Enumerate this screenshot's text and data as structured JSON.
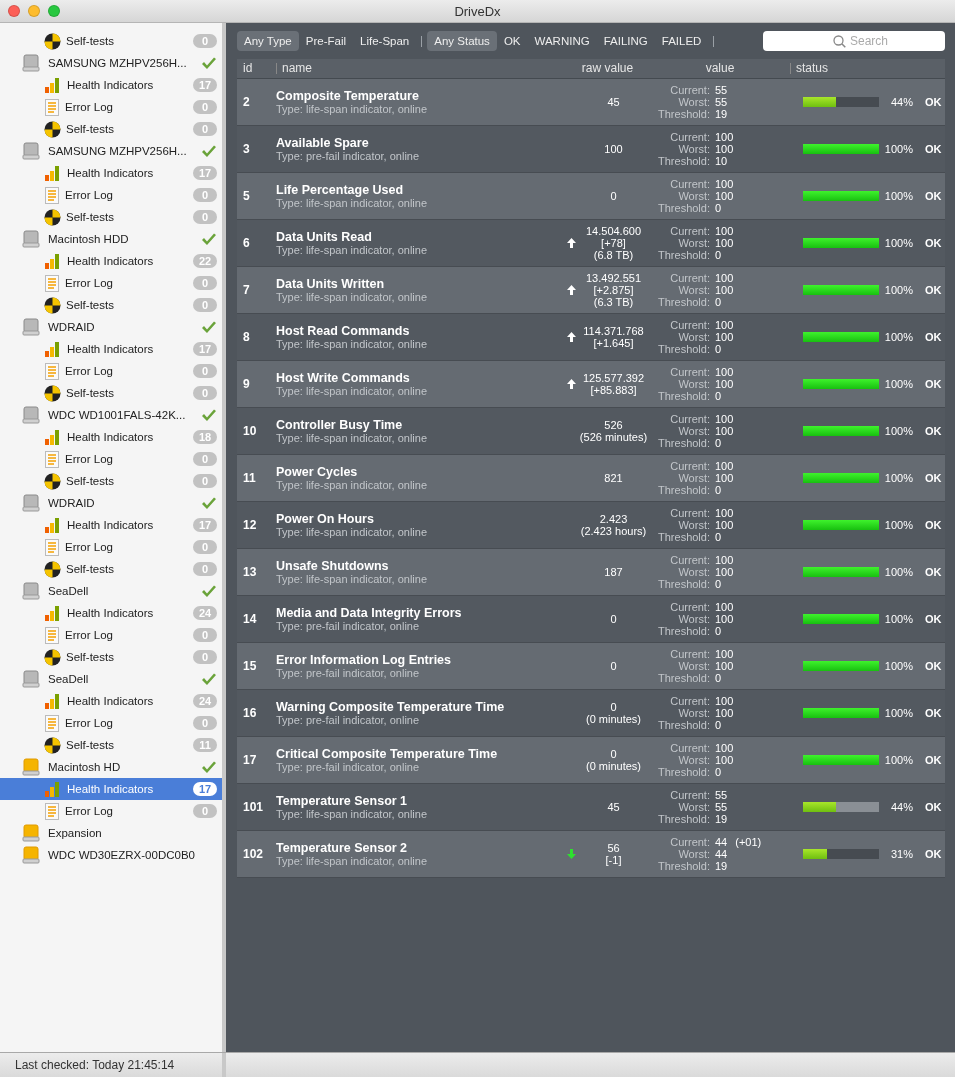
{
  "window": {
    "title": "DriveDx"
  },
  "sidebar": {
    "leading_items": [
      {
        "kind": "tests",
        "label": "Self-tests",
        "count": "0",
        "selected": false
      }
    ],
    "drives": [
      {
        "name": "SAMSUNG MZHPV256H...",
        "kind": "internal",
        "ok": true,
        "children": [
          {
            "kind": "health",
            "label": "Health Indicators",
            "count": "17",
            "selected": false
          },
          {
            "kind": "log",
            "label": "Error Log",
            "count": "0",
            "selected": false
          },
          {
            "kind": "tests",
            "label": "Self-tests",
            "count": "0",
            "selected": false
          }
        ]
      },
      {
        "name": "SAMSUNG MZHPV256H...",
        "kind": "internal",
        "ok": true,
        "children": [
          {
            "kind": "health",
            "label": "Health Indicators",
            "count": "17",
            "selected": false
          },
          {
            "kind": "log",
            "label": "Error Log",
            "count": "0",
            "selected": false
          },
          {
            "kind": "tests",
            "label": "Self-tests",
            "count": "0",
            "selected": false
          }
        ]
      },
      {
        "name": "Macintosh HDD",
        "kind": "internal",
        "ok": true,
        "children": [
          {
            "kind": "health",
            "label": "Health Indicators",
            "count": "22",
            "selected": false
          },
          {
            "kind": "log",
            "label": "Error Log",
            "count": "0",
            "selected": false
          },
          {
            "kind": "tests",
            "label": "Self-tests",
            "count": "0",
            "selected": false
          }
        ]
      },
      {
        "name": "WDRAID",
        "kind": "internal",
        "ok": true,
        "children": [
          {
            "kind": "health",
            "label": "Health Indicators",
            "count": "17",
            "selected": false
          },
          {
            "kind": "log",
            "label": "Error Log",
            "count": "0",
            "selected": false
          },
          {
            "kind": "tests",
            "label": "Self-tests",
            "count": "0",
            "selected": false
          }
        ]
      },
      {
        "name": "WDC WD1001FALS-42K...",
        "kind": "internal",
        "ok": true,
        "children": [
          {
            "kind": "health",
            "label": "Health Indicators",
            "count": "18",
            "selected": false
          },
          {
            "kind": "log",
            "label": "Error Log",
            "count": "0",
            "selected": false
          },
          {
            "kind": "tests",
            "label": "Self-tests",
            "count": "0",
            "selected": false
          }
        ]
      },
      {
        "name": "WDRAID",
        "kind": "internal",
        "ok": true,
        "children": [
          {
            "kind": "health",
            "label": "Health Indicators",
            "count": "17",
            "selected": false
          },
          {
            "kind": "log",
            "label": "Error Log",
            "count": "0",
            "selected": false
          },
          {
            "kind": "tests",
            "label": "Self-tests",
            "count": "0",
            "selected": false
          }
        ]
      },
      {
        "name": "SeaDell",
        "kind": "internal",
        "ok": true,
        "children": [
          {
            "kind": "health",
            "label": "Health Indicators",
            "count": "24",
            "selected": false
          },
          {
            "kind": "log",
            "label": "Error Log",
            "count": "0",
            "selected": false
          },
          {
            "kind": "tests",
            "label": "Self-tests",
            "count": "0",
            "selected": false
          }
        ]
      },
      {
        "name": "SeaDell",
        "kind": "internal",
        "ok": true,
        "children": [
          {
            "kind": "health",
            "label": "Health Indicators",
            "count": "24",
            "selected": false
          },
          {
            "kind": "log",
            "label": "Error Log",
            "count": "0",
            "selected": false
          },
          {
            "kind": "tests",
            "label": "Self-tests",
            "count": "11",
            "selected": false
          }
        ]
      },
      {
        "name": "Macintosh HD",
        "kind": "external",
        "ok": true,
        "children": [
          {
            "kind": "health",
            "label": "Health Indicators",
            "count": "17",
            "selected": true
          },
          {
            "kind": "log",
            "label": "Error Log",
            "count": "0",
            "selected": false
          }
        ]
      },
      {
        "name": "Expansion",
        "kind": "external",
        "ok": false
      },
      {
        "name": "WDC WD30EZRX-00DC0B0",
        "kind": "external",
        "ok": false
      }
    ]
  },
  "filters": {
    "type": [
      {
        "label": "Any Type",
        "selected": true
      },
      {
        "label": "Pre-Fail",
        "selected": false
      },
      {
        "label": "Life-Span",
        "selected": false
      }
    ],
    "status": [
      {
        "label": "Any Status",
        "selected": true
      },
      {
        "label": "OK",
        "selected": false
      },
      {
        "label": "WARNING",
        "selected": false
      },
      {
        "label": "FAILING",
        "selected": false
      },
      {
        "label": "FAILED",
        "selected": false
      }
    ]
  },
  "search": {
    "placeholder": "Search"
  },
  "table": {
    "columns": [
      "id",
      "name",
      "raw value",
      "value",
      "status"
    ],
    "rows": [
      {
        "id": "2",
        "name": "Composite Temperature",
        "type": "Type: life-span indicator, online",
        "raw": [
          "45"
        ],
        "values": [
          {
            "label": "Current:",
            "value": "55"
          },
          {
            "label": "Worst:",
            "value": "55"
          },
          {
            "label": "Threshold:",
            "value": "19"
          }
        ],
        "level": 0.44,
        "percent": "44%",
        "status": "OK"
      },
      {
        "id": "3",
        "name": "Available Spare",
        "type": "Type: pre-fail indicator, online",
        "raw": [
          "100"
        ],
        "values": [
          {
            "label": "Current:",
            "value": "100"
          },
          {
            "label": "Worst:",
            "value": "100"
          },
          {
            "label": "Threshold:",
            "value": "10"
          }
        ],
        "level": 1,
        "percent": "100%",
        "status": "OK"
      },
      {
        "id": "5",
        "name": "Life Percentage Used",
        "type": "Type: life-span indicator, online",
        "raw": [
          "0"
        ],
        "values": [
          {
            "label": "Current:",
            "value": "100"
          },
          {
            "label": "Worst:",
            "value": "100"
          },
          {
            "label": "Threshold:",
            "value": "0"
          }
        ],
        "level": 1,
        "percent": "100%",
        "status": "OK"
      },
      {
        "id": "6",
        "name": "Data Units Read",
        "type": "Type: life-span indicator, online",
        "raw": [
          "14.504.600",
          "[+78]",
          "(6.8 TB)"
        ],
        "rising": true,
        "values": [
          {
            "label": "Current:",
            "value": "100"
          },
          {
            "label": "Worst:",
            "value": "100"
          },
          {
            "label": "Threshold:",
            "value": "0"
          }
        ],
        "level": 1,
        "percent": "100%",
        "status": "OK"
      },
      {
        "id": "7",
        "name": "Data Units Written",
        "type": "Type: life-span indicator, online",
        "raw": [
          "13.492.551",
          "[+2.875]",
          "(6.3 TB)"
        ],
        "rising": true,
        "values": [
          {
            "label": "Current:",
            "value": "100"
          },
          {
            "label": "Worst:",
            "value": "100"
          },
          {
            "label": "Threshold:",
            "value": "0"
          }
        ],
        "level": 1,
        "percent": "100%",
        "status": "OK"
      },
      {
        "id": "8",
        "name": "Host Read Commands",
        "type": "Type: life-span indicator, online",
        "raw": [
          "114.371.768",
          "[+1.645]"
        ],
        "rising": true,
        "values": [
          {
            "label": "Current:",
            "value": "100"
          },
          {
            "label": "Worst:",
            "value": "100"
          },
          {
            "label": "Threshold:",
            "value": "0"
          }
        ],
        "level": 1,
        "percent": "100%",
        "status": "OK"
      },
      {
        "id": "9",
        "name": "Host Write Commands",
        "type": "Type: life-span indicator, online",
        "raw": [
          "125.577.392",
          "[+85.883]"
        ],
        "rising": true,
        "values": [
          {
            "label": "Current:",
            "value": "100"
          },
          {
            "label": "Worst:",
            "value": "100"
          },
          {
            "label": "Threshold:",
            "value": "0"
          }
        ],
        "level": 1,
        "percent": "100%",
        "status": "OK"
      },
      {
        "id": "10",
        "name": "Controller Busy Time",
        "type": "Type: life-span indicator, online",
        "raw": [
          "526",
          "(526 minutes)"
        ],
        "values": [
          {
            "label": "Current:",
            "value": "100"
          },
          {
            "label": "Worst:",
            "value": "100"
          },
          {
            "label": "Threshold:",
            "value": "0"
          }
        ],
        "level": 1,
        "percent": "100%",
        "status": "OK"
      },
      {
        "id": "11",
        "name": "Power Cycles",
        "type": "Type: life-span indicator, online",
        "raw": [
          "821"
        ],
        "values": [
          {
            "label": "Current:",
            "value": "100"
          },
          {
            "label": "Worst:",
            "value": "100"
          },
          {
            "label": "Threshold:",
            "value": "0"
          }
        ],
        "level": 1,
        "percent": "100%",
        "status": "OK"
      },
      {
        "id": "12",
        "name": "Power On Hours",
        "type": "Type: life-span indicator, online",
        "raw": [
          "2.423",
          "(2.423 hours)"
        ],
        "values": [
          {
            "label": "Current:",
            "value": "100"
          },
          {
            "label": "Worst:",
            "value": "100"
          },
          {
            "label": "Threshold:",
            "value": "0"
          }
        ],
        "level": 1,
        "percent": "100%",
        "status": "OK"
      },
      {
        "id": "13",
        "name": "Unsafe Shutdowns",
        "type": "Type: life-span indicator, online",
        "raw": [
          "187"
        ],
        "values": [
          {
            "label": "Current:",
            "value": "100"
          },
          {
            "label": "Worst:",
            "value": "100"
          },
          {
            "label": "Threshold:",
            "value": "0"
          }
        ],
        "level": 1,
        "percent": "100%",
        "status": "OK"
      },
      {
        "id": "14",
        "name": "Media and Data Integrity Errors",
        "type": "Type: pre-fail indicator, online",
        "raw": [
          "0"
        ],
        "values": [
          {
            "label": "Current:",
            "value": "100"
          },
          {
            "label": "Worst:",
            "value": "100"
          },
          {
            "label": "Threshold:",
            "value": "0"
          }
        ],
        "level": 1,
        "percent": "100%",
        "status": "OK"
      },
      {
        "id": "15",
        "name": "Error Information Log Entries",
        "type": "Type: pre-fail indicator, online",
        "raw": [
          "0"
        ],
        "values": [
          {
            "label": "Current:",
            "value": "100"
          },
          {
            "label": "Worst:",
            "value": "100"
          },
          {
            "label": "Threshold:",
            "value": "0"
          }
        ],
        "level": 1,
        "percent": "100%",
        "status": "OK"
      },
      {
        "id": "16",
        "name": "Warning Composite Temperature Time",
        "type": "Type: pre-fail indicator, online",
        "raw": [
          "0",
          "(0 minutes)"
        ],
        "values": [
          {
            "label": "Current:",
            "value": "100"
          },
          {
            "label": "Worst:",
            "value": "100"
          },
          {
            "label": "Threshold:",
            "value": "0"
          }
        ],
        "level": 1,
        "percent": "100%",
        "status": "OK"
      },
      {
        "id": "17",
        "name": "Critical Composite Temperature Time",
        "type": "Type: pre-fail indicator, online",
        "raw": [
          "0",
          "(0 minutes)"
        ],
        "values": [
          {
            "label": "Current:",
            "value": "100"
          },
          {
            "label": "Worst:",
            "value": "100"
          },
          {
            "label": "Threshold:",
            "value": "0"
          }
        ],
        "level": 1,
        "percent": "100%",
        "status": "OK"
      },
      {
        "id": "101",
        "name": "Temperature Sensor 1",
        "type": "Type: life-span indicator, online",
        "raw": [
          "45"
        ],
        "values": [
          {
            "label": "Current:",
            "value": "55"
          },
          {
            "label": "Worst:",
            "value": "55"
          },
          {
            "label": "Threshold:",
            "value": "19"
          }
        ],
        "level": 0.44,
        "percent": "44%",
        "status": "OK"
      },
      {
        "id": "102",
        "name": "Temperature Sensor 2",
        "type": "Type: life-span indicator, online",
        "raw": [
          "56",
          "[-1]"
        ],
        "falling": true,
        "values": [
          {
            "label": "Current:",
            "value": "44",
            "change": "(+01)"
          },
          {
            "label": "Worst:",
            "value": "44"
          },
          {
            "label": "Threshold:",
            "value": "19"
          }
        ],
        "level": 0.31,
        "percent": "31%",
        "status": "OK"
      }
    ]
  },
  "status_bar": {
    "text": "Last checked: Today 21:45:14"
  }
}
